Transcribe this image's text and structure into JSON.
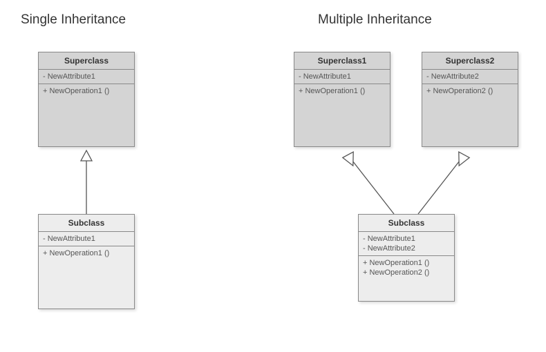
{
  "single": {
    "title": "Single Inheritance",
    "superclass": {
      "name": "Superclass",
      "attributes": [
        "- NewAttribute1"
      ],
      "operations": [
        "+ NewOperation1 ()"
      ]
    },
    "subclass": {
      "name": "Subclass",
      "attributes": [
        "- NewAttribute1"
      ],
      "operations": [
        "+ NewOperation1 ()"
      ]
    }
  },
  "multiple": {
    "title": "Multiple Inheritance",
    "superclass1": {
      "name": "Superclass1",
      "attributes": [
        "- NewAttribute1"
      ],
      "operations": [
        "+ NewOperation1 ()"
      ]
    },
    "superclass2": {
      "name": "Superclass2",
      "attributes": [
        "- NewAttribute2"
      ],
      "operations": [
        "+ NewOperation2 ()"
      ]
    },
    "subclass": {
      "name": "Subclass",
      "attributes": [
        "- NewAttribute1",
        "- NewAttribute2"
      ],
      "operations": [
        "+ NewOperation1 ()",
        "+ NewOperation2 ()"
      ]
    }
  },
  "chart_data": {
    "type": "table",
    "description": "UML class diagram comparing single vs multiple inheritance",
    "classes": [
      {
        "name": "Superclass",
        "side": "single",
        "attributes": [
          "NewAttribute1"
        ],
        "operations": [
          "NewOperation1()"
        ]
      },
      {
        "name": "Subclass",
        "side": "single",
        "extends": [
          "Superclass"
        ],
        "attributes": [
          "NewAttribute1"
        ],
        "operations": [
          "NewOperation1()"
        ]
      },
      {
        "name": "Superclass1",
        "side": "multiple",
        "attributes": [
          "NewAttribute1"
        ],
        "operations": [
          "NewOperation1()"
        ]
      },
      {
        "name": "Superclass2",
        "side": "multiple",
        "attributes": [
          "NewAttribute2"
        ],
        "operations": [
          "NewOperation2()"
        ]
      },
      {
        "name": "Subclass",
        "side": "multiple",
        "extends": [
          "Superclass1",
          "Superclass2"
        ],
        "attributes": [
          "NewAttribute1",
          "NewAttribute2"
        ],
        "operations": [
          "NewOperation1()",
          "NewOperation2()"
        ]
      }
    ]
  }
}
